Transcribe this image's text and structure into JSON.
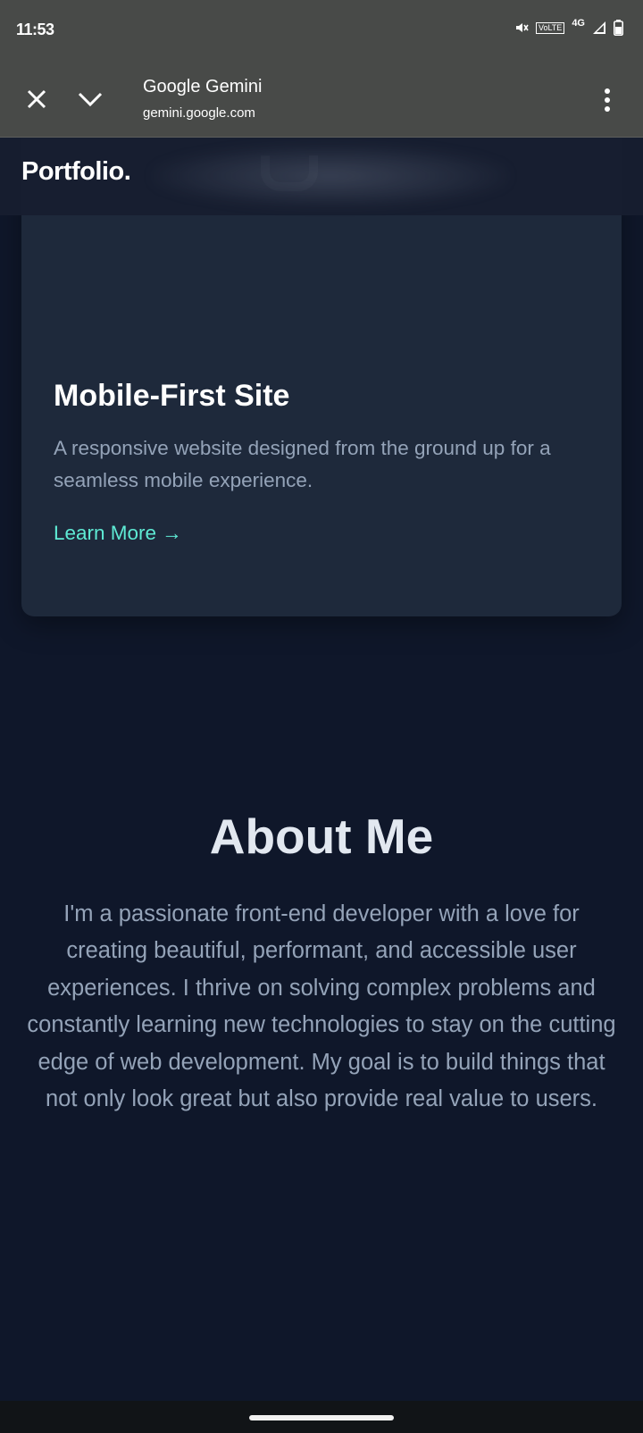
{
  "status_bar": {
    "time": "11:53",
    "volte": "VoLTE",
    "network": "4G",
    "icons": [
      "mute-icon",
      "signal-icon",
      "battery-icon"
    ]
  },
  "browser": {
    "title": "Google Gemini",
    "url": "gemini.google.com",
    "icons": [
      "close-icon",
      "chevron-down-icon",
      "more-vert-icon"
    ]
  },
  "site": {
    "logo": "Portfolio.",
    "colors": {
      "background": "#0f172a",
      "card": "#1e293b",
      "accent": "#5eead4",
      "muted_text": "#94a3b8"
    }
  },
  "project_card": {
    "title": "Mobile-First Site",
    "description": "A responsive website designed from the ground up for a seamless mobile experience.",
    "link": "Learn More →"
  },
  "about": {
    "title": "About Me",
    "text": "I'm a passionate front-end developer with a love for creating beautiful, performant, and accessible user experiences. I thrive on solving complex problems and constantly learning new technologies to stay on the cutting edge of web development. My goal is to build things that not only look great but also provide real value to users."
  }
}
